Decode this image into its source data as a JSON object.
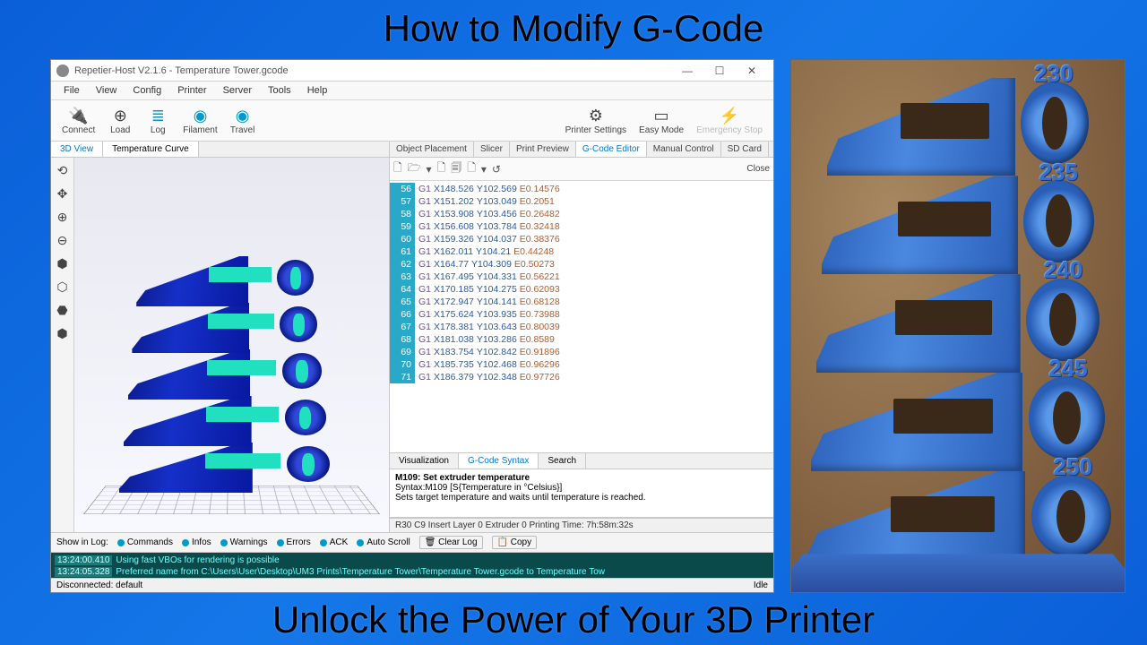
{
  "overlay": {
    "title_top": "How to Modify G-Code",
    "title_bottom": "Unlock the Power of Your 3D Printer"
  },
  "window": {
    "title": "Repetier-Host V2.1.6 - Temperature Tower.gcode"
  },
  "menu": [
    "File",
    "View",
    "Config",
    "Printer",
    "Server",
    "Tools",
    "Help"
  ],
  "toolbar": [
    {
      "label": "Connect",
      "icon": "🔌"
    },
    {
      "label": "Load",
      "icon": "⊕"
    },
    {
      "label": "Log",
      "icon": "≣"
    },
    {
      "label": "Filament",
      "icon": "◉"
    },
    {
      "label": "Travel",
      "icon": "◉"
    }
  ],
  "toolbar_right": [
    {
      "label": "Printer Settings",
      "icon": "⚙"
    },
    {
      "label": "Easy Mode",
      "icon": "▭"
    },
    {
      "label": "Emergency Stop",
      "icon": "⚡"
    }
  ],
  "view_tabs": [
    "3D View",
    "Temperature Curve"
  ],
  "view_icons": [
    "⟲",
    "✥",
    "⊕",
    "⊖",
    "⬢",
    "⬡",
    "⬣",
    "⬢"
  ],
  "obj_tabs": [
    "Object Placement",
    "Slicer",
    "Print Preview",
    "G-Code Editor",
    "Manual Control",
    "SD Card"
  ],
  "obj_active": 3,
  "editor_icons": [
    "🗋",
    "🗁",
    "▾",
    "🗋",
    "🗐",
    "🗋",
    "▾",
    "↺"
  ],
  "close_label": "Close",
  "gcode": [
    {
      "n": 56,
      "t": "G1 X148.526 Y102.569 E0.14576"
    },
    {
      "n": 57,
      "t": "G1 X151.202 Y103.049 E0.2051"
    },
    {
      "n": 58,
      "t": "G1 X153.908 Y103.456 E0.26482"
    },
    {
      "n": 59,
      "t": "G1 X156.608 Y103.784 E0.32418"
    },
    {
      "n": 60,
      "t": "G1 X159.326 Y104.037 E0.38376"
    },
    {
      "n": 61,
      "t": "G1 X162.011 Y104.21 E0.44248"
    },
    {
      "n": 62,
      "t": "G1 X164.77 Y104.309 E0.50273"
    },
    {
      "n": 63,
      "t": "G1 X167.495 Y104.331 E0.56221"
    },
    {
      "n": 64,
      "t": "G1 X170.185 Y104.275 E0.62093"
    },
    {
      "n": 65,
      "t": "G1 X172.947 Y104.141 E0.68128"
    },
    {
      "n": 66,
      "t": "G1 X175.624 Y103.935 E0.73988"
    },
    {
      "n": 67,
      "t": "G1 X178.381 Y103.643 E0.80039"
    },
    {
      "n": 68,
      "t": "G1 X181.038 Y103.286 E0.8589"
    },
    {
      "n": 69,
      "t": "G1 X183.754 Y102.842 E0.91896"
    },
    {
      "n": 70,
      "t": "G1 X185.735 Y102.468 E0.96296"
    },
    {
      "n": 71,
      "t": "G1 X186.379 Y102.348 E0.97726"
    }
  ],
  "sub_tabs": [
    "Visualization",
    "G-Code Syntax",
    "Search"
  ],
  "sub_active": 1,
  "help": {
    "title": "M109: Set extruder temperature",
    "syntax": "Syntax:M109 [S{Temperature in °Celsius}]",
    "desc": "Sets target temperature and waits until temperature is reached."
  },
  "status": "R30  C9 Insert  Layer 0  Extruder 0  Printing Time: 7h:58m:32s",
  "log_controls": {
    "show": "Show in Log:",
    "items": [
      "Commands",
      "Infos",
      "Warnings",
      "Errors",
      "ACK",
      "Auto Scroll"
    ],
    "clear": "Clear Log",
    "copy": "Copy"
  },
  "log": [
    {
      "ts": "13:24:00.410",
      "msg": "Using fast VBOs for rendering is possible"
    },
    {
      "ts": "13:24:05.328",
      "msg": "Preferred name from C:\\Users\\User\\Desktop\\UM3 Prints\\Temperature Tower\\Temperature Tower.gcode to Temperature Tow"
    }
  ],
  "footer": {
    "left": "Disconnected: default",
    "right": "Idle"
  },
  "temps": [
    "230",
    "235",
    "240",
    "245",
    "250"
  ]
}
